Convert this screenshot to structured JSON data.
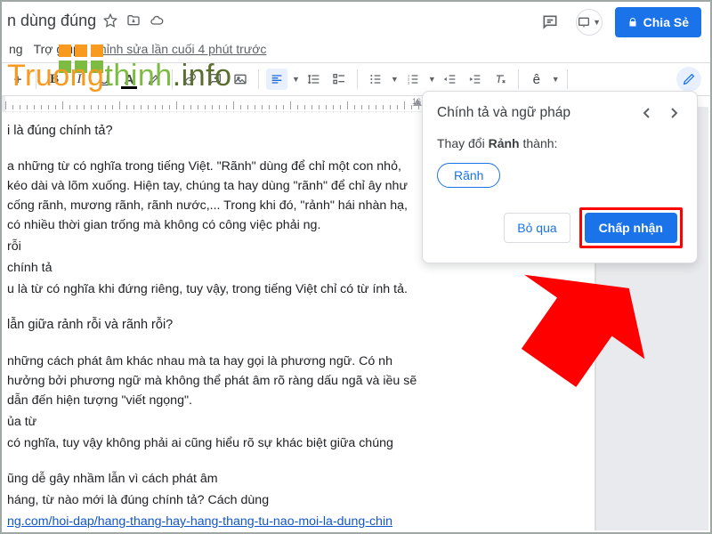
{
  "header": {
    "doc_title_fragment": "n dùng đúng",
    "menu_help": "Trợ giúp",
    "edit_history": "Chỉnh sửa lần cuối 4 phút trước",
    "share_label": "Chia Sẻ"
  },
  "ruler": {
    "mark": "16"
  },
  "document": {
    "q1": "i là đúng chính tả?",
    "p1": "a những từ có nghĩa trong tiếng Việt. \"Rãnh\" dùng để chỉ một con nhỏ, kéo dài và lõm xuống. Hiện tay, chúng ta hay dùng \"rãnh\" để chỉ ây như cống rãnh, mương rãnh, rãnh nước,... Trong khi đó, \"rảnh\" hái nhàn hạ, có nhiều thời gian trống mà không có công việc phải ng.",
    "s1": "rỗi",
    "s2": "chính tả",
    "p2": "u là từ có nghĩa khi đứng riêng, tuy vậy, trong tiếng Việt chỉ có từ ính tả.",
    "q2": "lẫn giữa rảnh rỗi và rãnh rỗi?",
    "p3": "những cách phát âm khác nhau mà ta hay gọi là phương ngữ. Có nh hưởng bởi phương ngữ mà không thể phát âm rõ ràng dấu ngã và iều sẽ dẫn đến hiện tượng \"viết ngọng\".",
    "s3": "ủa từ",
    "p4": "có nghĩa, tuy vậy không phải ai cũng hiểu rõ sự khác biệt giữa chúng",
    "p5": "ũng dễ gây nhầm lẫn vì cách phát âm",
    "p6": "háng, từ nào mới là đúng chính tả? Cách dùng",
    "link": "ng.com/hoi-dap/hang-thang-hay-hang-thang-tu-nao-moi-la-dung-chin"
  },
  "panel": {
    "title": "Chính tả và ngữ pháp",
    "change_prefix": "Thay đổi ",
    "change_word": "Rảnh",
    "change_suffix": " thành:",
    "suggestion": "Rãnh",
    "ignore": "Bỏ qua",
    "accept": "Chấp nhận"
  },
  "watermark": {
    "part1": "Truong",
    "part2": "thinh",
    "dot": ".",
    "part3": "info"
  },
  "toolbar": {
    "b": "B",
    "i": "I",
    "u": "U",
    "a": "A",
    "e": "ê"
  }
}
